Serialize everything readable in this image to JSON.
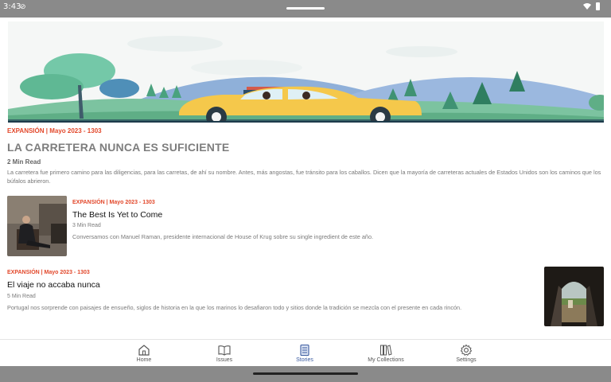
{
  "status_bar": {
    "time": "3:43"
  },
  "feature": {
    "meta": "EXPANSIÓN | Mayo 2023 - 1303",
    "title": "LA CARRETERA NUNCA ES SUFICIENTE",
    "read_time": "2 Min Read",
    "description": "La carretera fue primero camino para las diligencias, para las carretas, de ahí su nombre. Antes, más angostas, fue tránsito para los caballos. Dicen que la mayoría de carreteras actuales de Estados Unidos son los caminos que los búfalos abrieron."
  },
  "stories": [
    {
      "meta": "EXPANSIÓN | Mayo 2023 - 1303",
      "title": "The Best Is Yet to Come",
      "read_time": "3 Min Read",
      "description": "Conversamos con Manuel Raman, presidente internacional de House of Krug sobre su single ingredient de este año."
    },
    {
      "meta": "EXPANSIÓN | Mayo 2023 - 1303",
      "title": "El viaje no accaba nunca",
      "read_time": "5 Min Read",
      "description": "Portugal nos sorprende con paisajes de ensueño, siglos de historia en la que los marinos lo desafiaron todo y sitios donde la tradición se mezcla con el presente en cada rincón."
    }
  ],
  "nav": {
    "items": [
      {
        "label": "Home",
        "icon": "home-icon"
      },
      {
        "label": "Issues",
        "icon": "book-open-icon"
      },
      {
        "label": "Stories",
        "icon": "document-icon",
        "active": true
      },
      {
        "label": "My Collections",
        "icon": "library-icon"
      },
      {
        "label": "Settings",
        "icon": "gear-icon"
      }
    ]
  },
  "colors": {
    "accent_red": "#e2482b",
    "nav_active": "#3a5aa0",
    "system_bar": "#8a8a8a"
  }
}
